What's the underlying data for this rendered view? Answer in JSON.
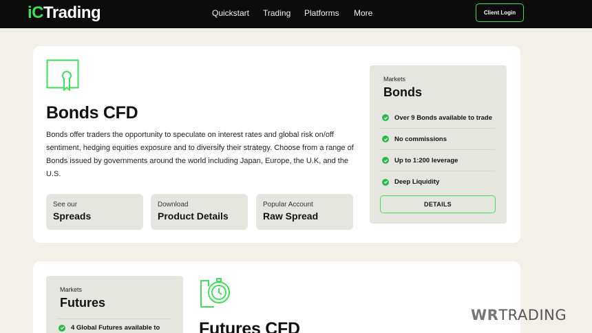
{
  "header": {
    "logo_prefix": "iC",
    "logo_suffix": "Trading",
    "nav": [
      "Quickstart",
      "Trading",
      "Platforms",
      "More"
    ],
    "client_login": "Client Login"
  },
  "bonds": {
    "title": "Bonds CFD",
    "description": "Bonds offer traders the opportunity to speculate on interest rates and global risk on/off sentiment, hedging equities exposure and to diversify their strategy. Choose from a range of Bonds issued by governments around the world including Japan, Europe, the U.K, and the U.S.",
    "pills": [
      {
        "small": "See our",
        "big": "Spreads"
      },
      {
        "small": "Download",
        "big": "Product Details"
      },
      {
        "small": "Popular Account",
        "big": "Raw Spread"
      }
    ],
    "markets": {
      "small": "Markets",
      "big": "Bonds",
      "features": [
        "Over 9 Bonds available to trade",
        "No commissions",
        "Up to 1:200 leverage",
        "Deep Liquidity"
      ],
      "details_label": "DETAILS"
    }
  },
  "futures": {
    "title": "Futures CFD",
    "markets": {
      "small": "Markets",
      "big": "Futures",
      "features": [
        "4 Global Futures available to"
      ]
    }
  },
  "watermark": {
    "prefix": "WR",
    "suffix": "TRADING"
  },
  "colors": {
    "accent": "#3ee05a",
    "header_bg": "#0b0b0b",
    "page_bg": "#f3f0e9",
    "panel_bg": "#e6e6e1",
    "check": "#2bb84a"
  }
}
